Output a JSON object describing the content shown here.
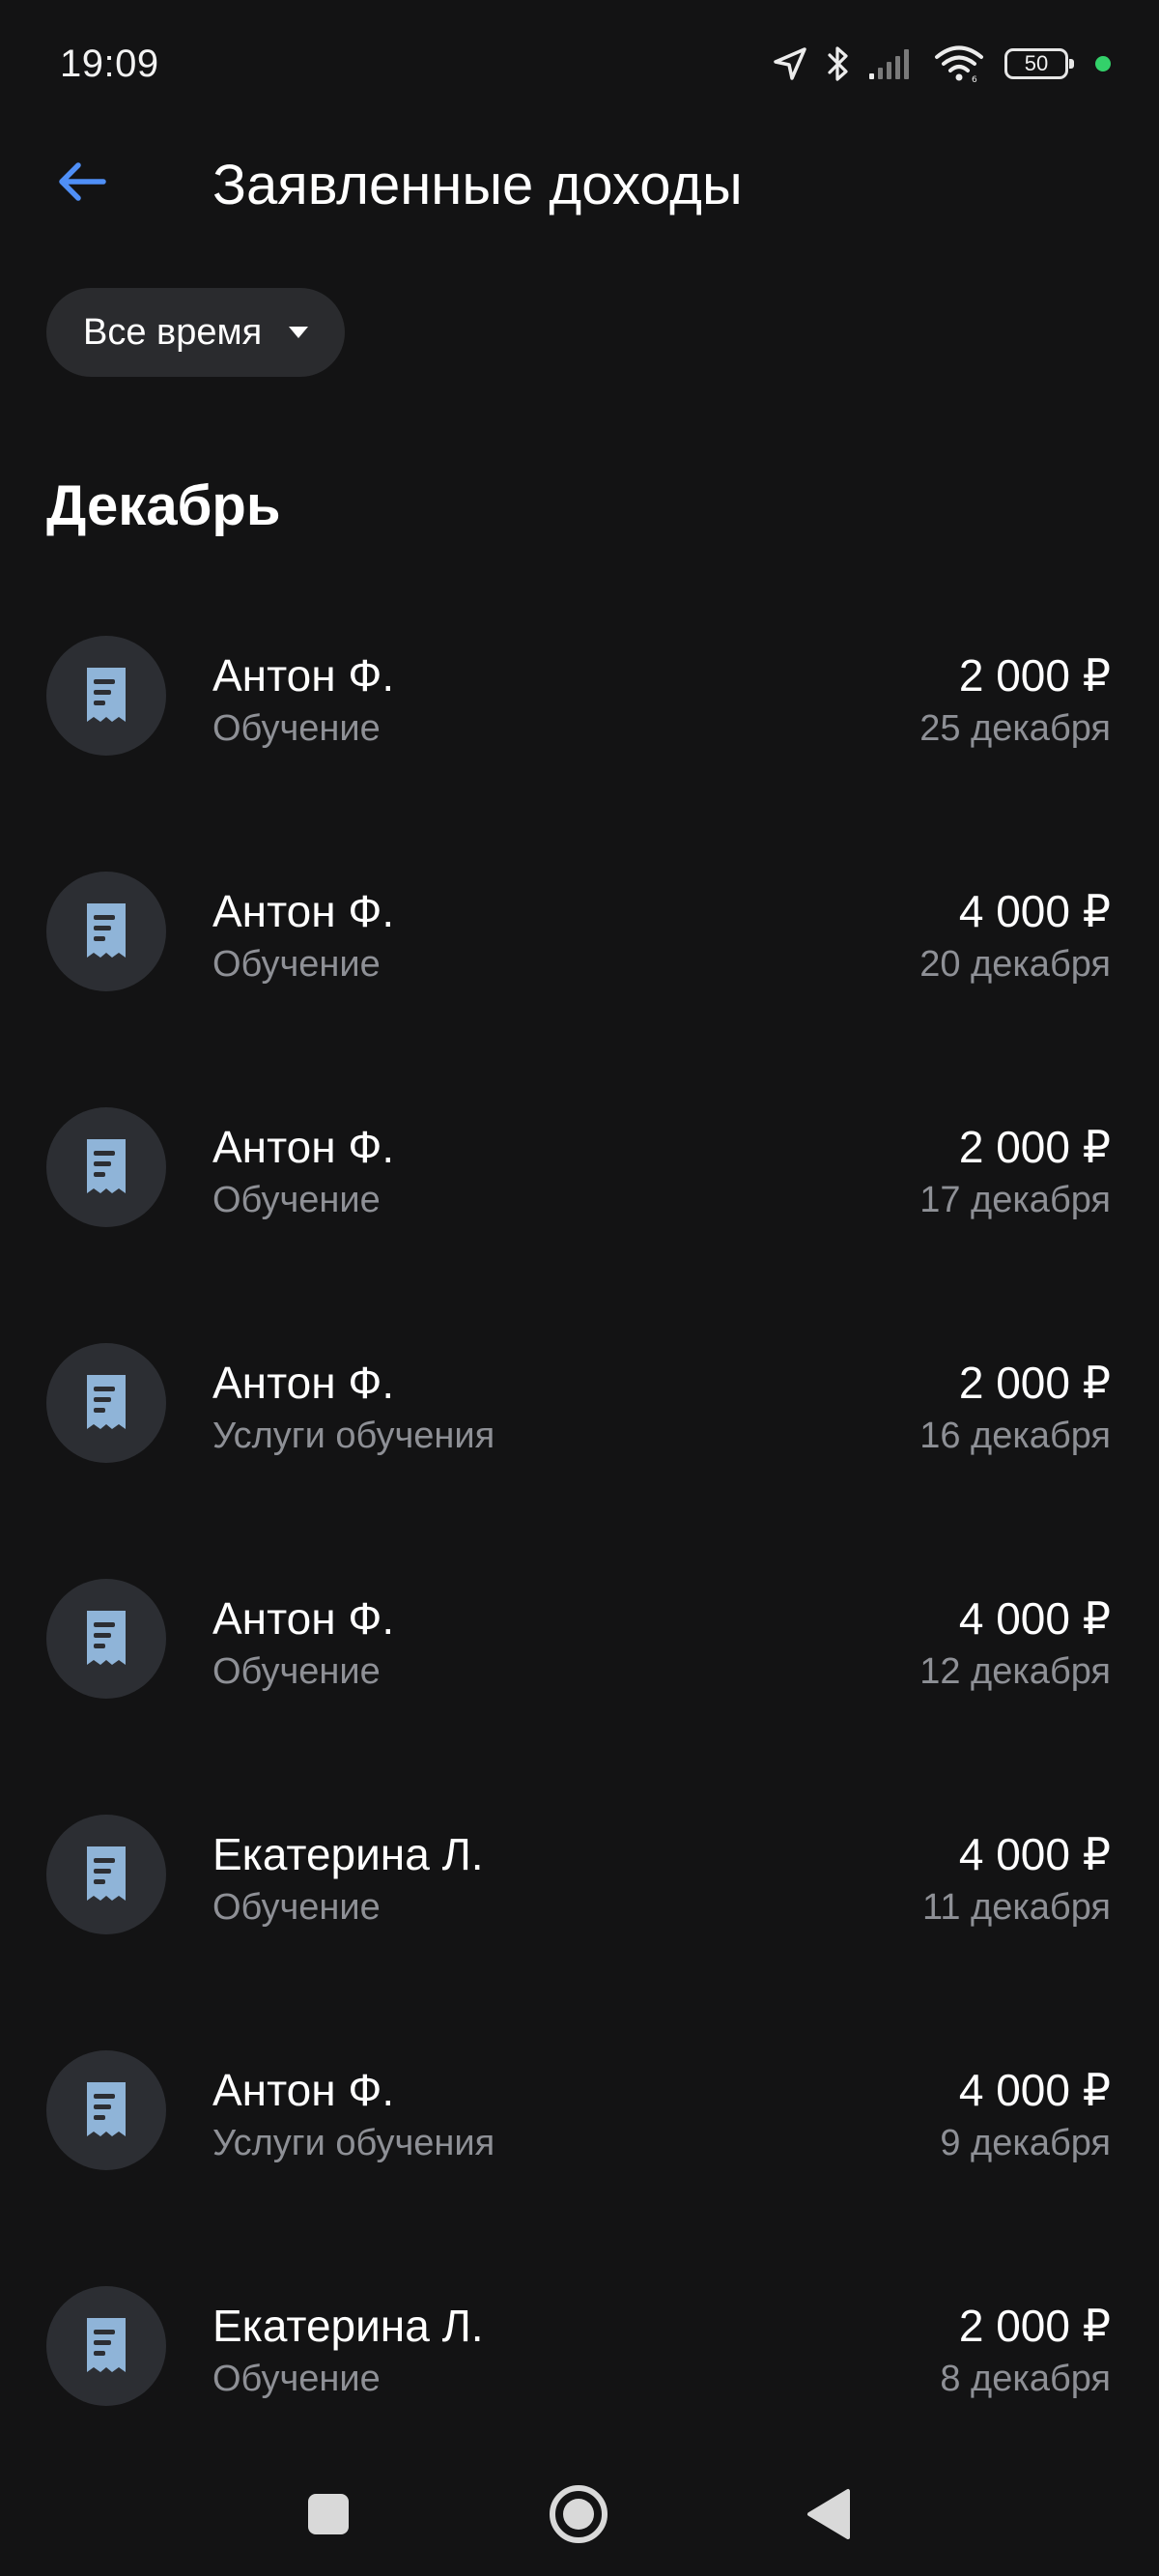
{
  "status_bar": {
    "time": "19:09",
    "battery": "50",
    "icons": [
      "location-arrow-icon",
      "bluetooth-icon",
      "signal-icon",
      "wifi-icon",
      "battery-icon",
      "active-dot-icon"
    ]
  },
  "header": {
    "back_icon": "arrow-left-icon",
    "title": "Заявленные доходы"
  },
  "filter": {
    "label": "Все время",
    "icon": "caret-down-icon"
  },
  "section": {
    "title": "Декабрь"
  },
  "items": [
    {
      "name": "Антон Ф.",
      "category": "Обучение",
      "amount": "2 000 ₽",
      "date": "25 декабря"
    },
    {
      "name": "Антон Ф.",
      "category": "Обучение",
      "amount": "4 000 ₽",
      "date": "20 декабря"
    },
    {
      "name": "Антон Ф.",
      "category": "Обучение",
      "amount": "2 000 ₽",
      "date": "17 декабря"
    },
    {
      "name": "Антон Ф.",
      "category": "Услуги обучения",
      "amount": "2 000 ₽",
      "date": "16 декабря"
    },
    {
      "name": "Антон Ф.",
      "category": "Обучение",
      "amount": "4 000 ₽",
      "date": "12 декабря"
    },
    {
      "name": "Екатерина Л.",
      "category": "Обучение",
      "amount": "4 000 ₽",
      "date": "11 декабря"
    },
    {
      "name": "Антон Ф.",
      "category": "Услуги обучения",
      "amount": "4 000 ₽",
      "date": "9 декабря"
    },
    {
      "name": "Екатерина Л.",
      "category": "Обучение",
      "amount": "2 000 ₽",
      "date": "8 декабря"
    }
  ],
  "item_icon": "receipt-icon",
  "colors": {
    "background": "#131314",
    "accent": "#4f8ff7",
    "icon_circle": "#2c2e33",
    "receipt_icon": "#8fb4d8",
    "secondary_text": "#8e9096",
    "chip_background": "#2a2b2e",
    "status_green": "#33d16a"
  },
  "nav_bar": {
    "buttons": [
      "recent-apps-icon",
      "home-icon",
      "back-triangle-icon"
    ]
  }
}
